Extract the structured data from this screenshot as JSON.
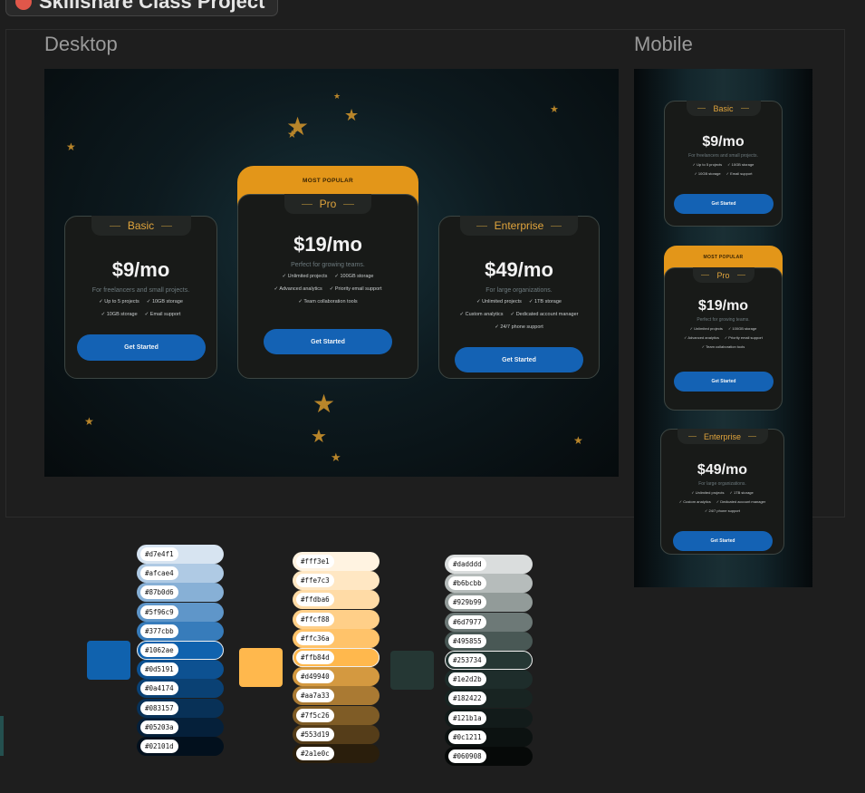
{
  "project": {
    "title": "Skillshare Class Project"
  },
  "frames": {
    "desktop_label": "Desktop",
    "mobile_label": "Mobile"
  },
  "pricing": {
    "basic": {
      "name": "Basic",
      "price": "$9/mo",
      "tagline": "For freelancers and small projects.",
      "features_row1": [
        "Up to 5 projects",
        "10GB storage"
      ],
      "features_row2": [
        "10GB storage",
        "Email support"
      ],
      "cta": "Get Started"
    },
    "pro": {
      "badge": "MOST POPULAR",
      "name": "Pro",
      "price": "$19/mo",
      "tagline": "Perfect for growing teams.",
      "features_row1": [
        "Unlimited projects",
        "100GB storage"
      ],
      "features_row2": [
        "Advanced analytics",
        "Priority email support"
      ],
      "features_row3": [
        "Team collaboration tools"
      ],
      "cta": "Get Started"
    },
    "enterprise": {
      "name": "Enterprise",
      "price": "$49/mo",
      "tagline": "For large organizations.",
      "features_row1": [
        "Unlimited projects",
        "1TB storage"
      ],
      "features_row2": [
        "Custom analytics",
        "Dedicated account manager"
      ],
      "features_row3": [
        "24/7 phone support"
      ],
      "cta": "Get Started"
    }
  },
  "palette": {
    "blue": {
      "base": "#1062ae",
      "shades": [
        "#d7e4f1",
        "#afcae4",
        "#87b0d6",
        "#5f96c9",
        "#377cbb",
        "#1062ae",
        "#0d5191",
        "#0a4174",
        "#083157",
        "#05203a",
        "#02101d"
      ],
      "text": [
        "#d7e4f1",
        "#afcae4",
        "#87b0d6",
        "#5f96c9",
        "#377cbb",
        "#1062ae",
        "#0d5191",
        "#0a4174",
        "#083157",
        "#05203a",
        "#02101d"
      ]
    },
    "orange": {
      "base": "#ffb84d",
      "shades": [
        "#fff3e1",
        "#ffe7c3",
        "#ffdba6",
        "#ffcf88",
        "#ffc36a",
        "#ffb84d",
        "#d49940",
        "#aa7a33",
        "#7f5c26",
        "#553d19",
        "#2a1e0c"
      ],
      "text": [
        "#fff3e1",
        "#ffe7c3",
        "#ffdba6",
        "#ffcf88",
        "#ffc36a",
        "#ffb84d",
        "#d49940",
        "#aa7a33",
        "#7f5c26",
        "#553d19",
        "#2a1e0c"
      ]
    },
    "gray": {
      "base": "#253734",
      "shades": [
        "#dadddd",
        "#b6bcbb",
        "#929b99",
        "#6d7977",
        "#495855",
        "#253734",
        "#1e2d2b",
        "#182422",
        "#121b1a",
        "#0c1211",
        "#060908"
      ],
      "text": [
        "#dadddd",
        "#b6bcbb",
        "#929b99",
        "#6d7977",
        "#495855",
        "#253734",
        "#1e2d2b",
        "#182422",
        "#121b1a",
        "#0c1211",
        "#060908"
      ]
    }
  }
}
